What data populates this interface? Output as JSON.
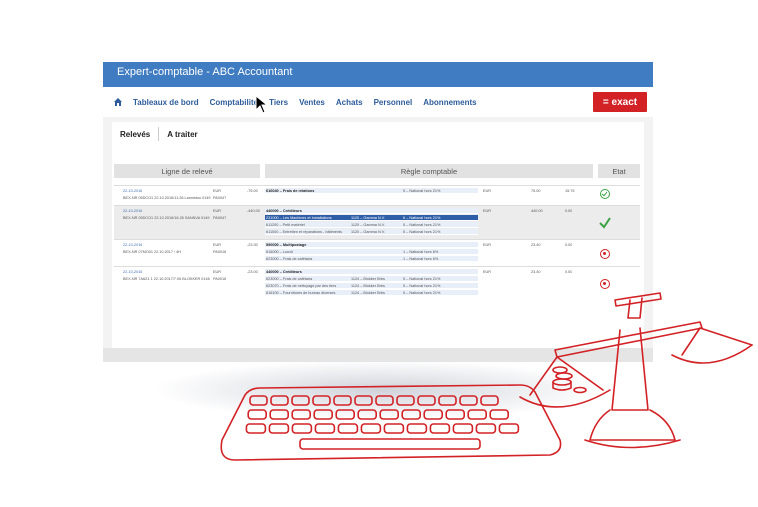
{
  "window": {
    "title": "Expert-comptable - ABC Accountant"
  },
  "nav": {
    "items": [
      "Tableaux de bord",
      "Comptabilité",
      "Tiers",
      "Ventes",
      "Achats",
      "Personnel",
      "Abonnements"
    ],
    "logo": "= exact"
  },
  "tabs": [
    "Relevés",
    "A traiter"
  ],
  "headers": {
    "statement": "Ligne de relevé",
    "rule": "Règle comptable",
    "status": "Etat"
  },
  "rows": [
    {
      "date": "22-10-2016",
      "desc": "BEX-NR 05DCO1 22.10.2016/11.26 Lannistoo 0149",
      "currency": "EUR",
      "amount": "-75.00",
      "code": "PA0047",
      "lines": [
        {
          "account": "616040 – Frais de relations",
          "journal": "",
          "vat": "5 – National hors 21%",
          "cur": "EUR",
          "amt": "75.00",
          "amt2": "15.75",
          "bold": true
        }
      ],
      "status": "ok"
    },
    {
      "date": "22-10-2016",
      "desc": "BEX-NR 05DCO1 22.10.2016/16.26 SANNVA 0149",
      "currency": "EUR",
      "amount": "-440.00",
      "code": "PA0047",
      "lines": [
        {
          "account": "440000 – Créditeurs",
          "journal": "",
          "vat": "",
          "cur": "EUR",
          "amt": "440.00",
          "amt2": "0.00",
          "bold": true
        },
        {
          "account": "231000 – Les Machines et Installations",
          "journal": "1120 – Gamma N.V.",
          "vat": "6 – National hors 21%",
          "cur": "",
          "amt": "",
          "amt2": "",
          "sel": true
        },
        {
          "account": "611200 – Petit matériel",
          "journal": "1120 – Gamma N.V.",
          "vat": "5 – National hors 21%",
          "cur": "",
          "amt": "",
          "amt2": ""
        },
        {
          "account": "611000 – Entretien et réparations - bâtiments",
          "journal": "1120 – Gamma N.V.",
          "vat": "5 – National hors 21%",
          "cur": "",
          "amt": "",
          "amt2": ""
        }
      ],
      "status": "bigcheck"
    },
    {
      "date": "22-10-2016",
      "desc": "BEX-NR 07MO01 22.10.2017 / 4H",
      "currency": "EUR",
      "amount": "-23.30",
      "code": "PA0016",
      "lines": [
        {
          "account": "590000 – Multipostage",
          "journal": "",
          "vat": "",
          "cur": "EUR",
          "amt": "23.40",
          "amt2": "0.00",
          "bold": true
        },
        {
          "account": "616000 – Lunch",
          "journal": "",
          "vat": "1 – National hors 6%",
          "cur": "",
          "amt": "",
          "amt2": ""
        },
        {
          "account": "623000 – Frais de cafétaria",
          "journal": "",
          "vat": "1 – National hors 6%",
          "cur": "",
          "amt": "",
          "amt2": ""
        }
      ],
      "status": "err"
    },
    {
      "date": "22-10-2016",
      "desc": "BEX-NR 7A6Z1 1 22.10.2017/7.06 BLOKKER 0146",
      "currency": "EUR",
      "amount": "-23.00",
      "code": "PA0016",
      "lines": [
        {
          "account": "440000 – Créditeurs",
          "journal": "",
          "vat": "",
          "cur": "EUR",
          "amt": "23.40",
          "amt2": "0.00",
          "bold": true
        },
        {
          "account": "623000 – Frais de cafétaria",
          "journal": "1124 – Blokker Brbs",
          "vat": "5 – National hors 21%",
          "cur": "",
          "amt": "",
          "amt2": ""
        },
        {
          "account": "623070 – Frais de nettoyage par des tiers",
          "journal": "1124 – Blokker Brbs",
          "vat": "5 – National hors 21%",
          "cur": "",
          "amt": "",
          "amt2": ""
        },
        {
          "account": "616100 – Fournitures de bureau diverses",
          "journal": "1124 – Blokker Brbs",
          "vat": "5 – National hors 21%",
          "cur": "",
          "amt": "",
          "amt2": ""
        }
      ],
      "status": "err"
    }
  ],
  "colors": {
    "brand_blue": "#3f7cc1",
    "exact_red": "#d32226",
    "ok_green": "#3aa244"
  },
  "icons": {
    "home": "home-icon",
    "cursor": "cursor-icon",
    "ok": "check-circle-icon",
    "error": "error-circle-icon",
    "keyboard": "keyboard-sketch-icon",
    "scale": "balance-scale-icon"
  }
}
